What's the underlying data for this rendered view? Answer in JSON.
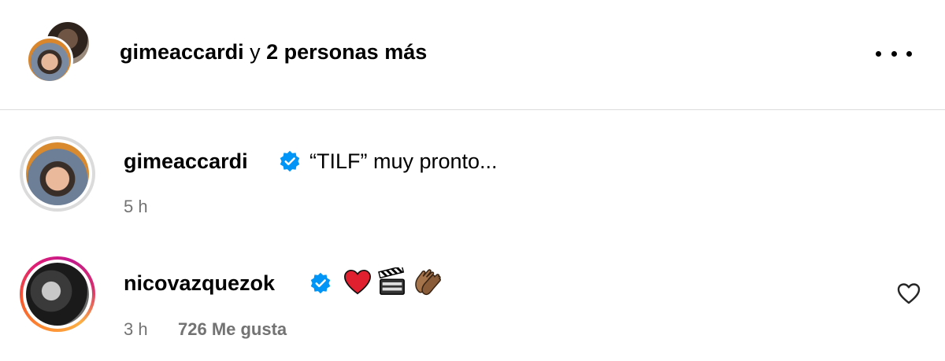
{
  "header": {
    "username": "gimeaccardi",
    "connector": "y",
    "others": "2 personas más",
    "more_icon": "more-horizontal-icon"
  },
  "comments": [
    {
      "username": "gimeaccardi",
      "verified": true,
      "text": "“TILF” muy pronto...",
      "time": "5 h"
    },
    {
      "username": "nicovazquezok",
      "verified": true,
      "emojis": [
        "red-heart-emoji",
        "clapper-board-emoji",
        "clapping-hands-emoji"
      ],
      "time": "3 h",
      "likes": "726 Me gusta",
      "like_icon": "heart-outline-icon"
    }
  ],
  "colors": {
    "verified_blue": "#0095f6",
    "secondary_text": "#737373",
    "divider": "#dbdbdb"
  }
}
